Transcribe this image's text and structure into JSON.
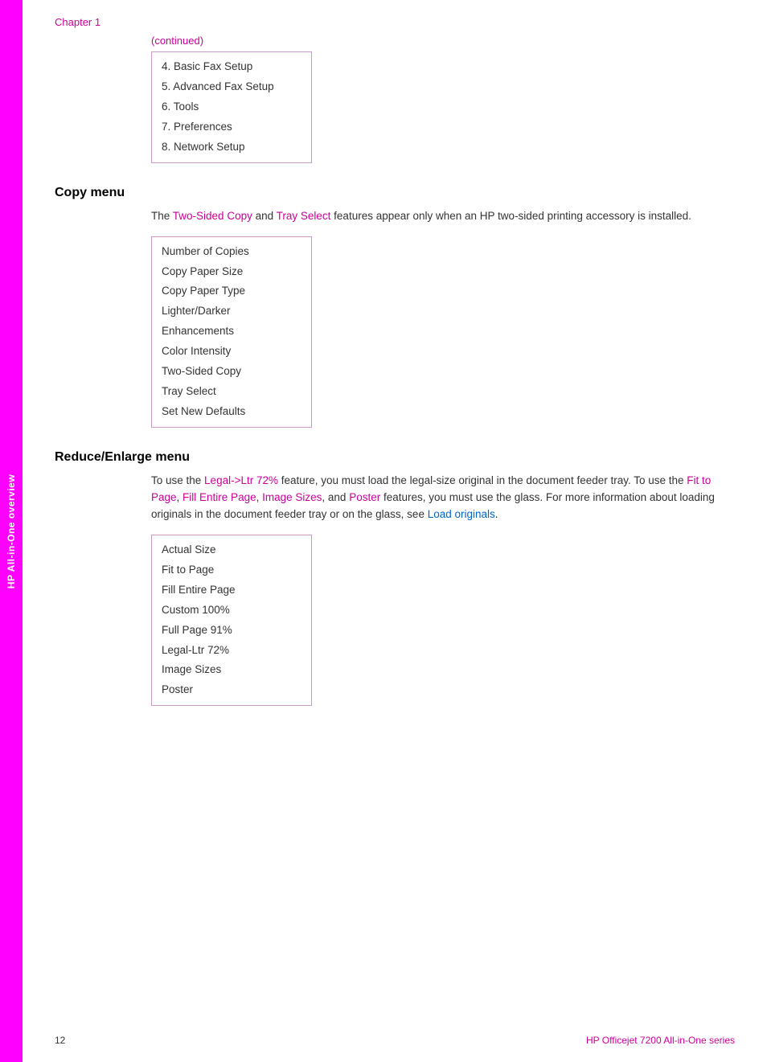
{
  "page": {
    "number": "12",
    "footer_left": "12",
    "footer_right": "HP Officejet 7200 All-in-One series"
  },
  "left_tab": {
    "label": "HP All-in-One overview"
  },
  "chapter": {
    "label": "Chapter 1"
  },
  "continued": {
    "label": "(continued)"
  },
  "setup_menu": {
    "items": [
      "4. Basic Fax Setup",
      "5. Advanced Fax Setup",
      "6. Tools",
      "7. Preferences",
      "8. Network Setup"
    ]
  },
  "copy_menu": {
    "title": "Copy menu",
    "description_before": "The ",
    "two_sided_copy": "Two-Sided Copy",
    "description_mid": " and ",
    "tray_select": "Tray Select",
    "description_after": " features appear only when an HP two-sided printing accessory is installed.",
    "items": [
      "Number of Copies",
      "Copy Paper Size",
      "Copy Paper Type",
      "Lighter/Darker",
      "Enhancements",
      "Color Intensity",
      "Two-Sided Copy",
      "Tray Select",
      "Set New Defaults"
    ]
  },
  "reduce_enlarge_menu": {
    "title": "Reduce/Enlarge menu",
    "description_parts": [
      "To use the ",
      "Legal->Ltr 72%",
      " feature, you must load the legal-size original in the document feeder tray. To use the ",
      "Fit to Page",
      ", ",
      "Fill Entire Page",
      ", ",
      "Image Sizes",
      ", and ",
      "Poster",
      " features, you must use the glass. For more information about loading originals in the document feeder tray or on the glass, see ",
      "Load originals",
      "."
    ],
    "items": [
      "Actual Size",
      "Fit to Page",
      "Fill Entire Page",
      "Custom 100%",
      "Full Page 91%",
      "Legal-Ltr 72%",
      "Image Sizes",
      "Poster"
    ]
  }
}
